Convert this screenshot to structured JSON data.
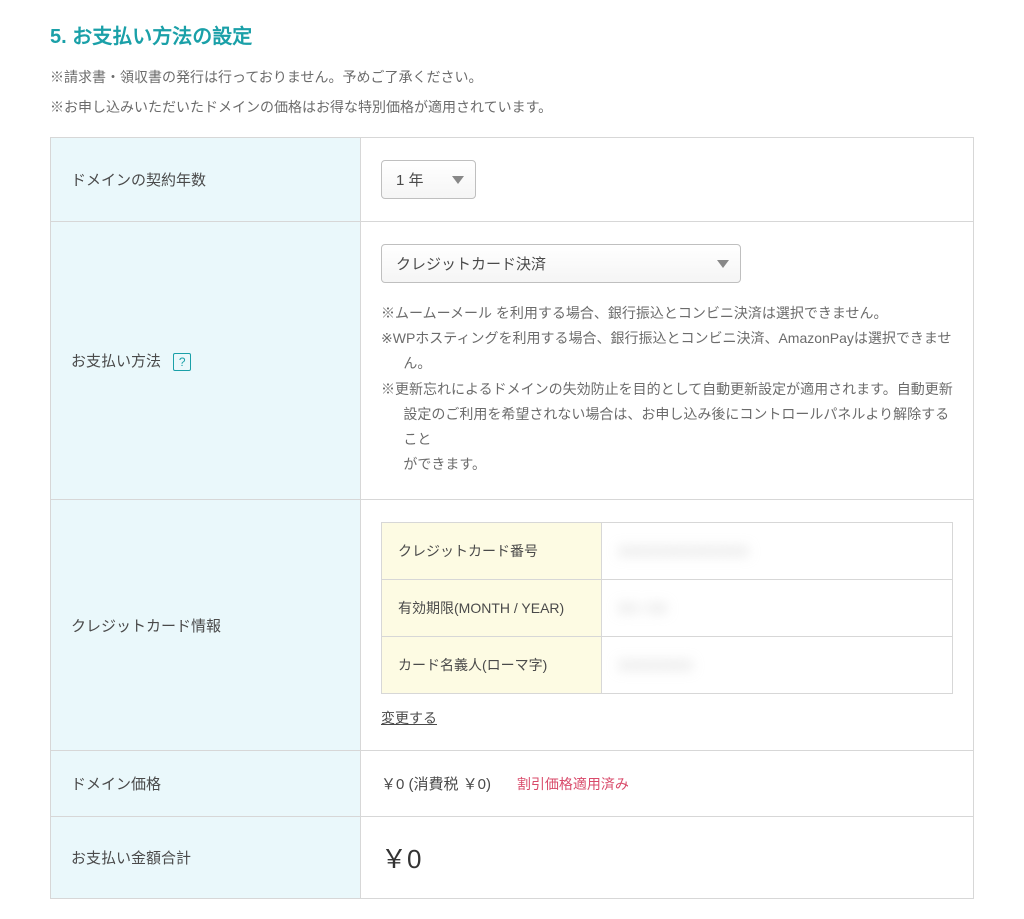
{
  "section": {
    "title": "5. お支払い方法の設定",
    "note1": "※請求書・領収書の発行は行っておりません。予めご了承ください。",
    "note2": "※お申し込みいただいたドメインの価格はお得な特別価格が適用されています。"
  },
  "rows": {
    "contractYears": {
      "label": "ドメインの契約年数",
      "selected": "1 年"
    },
    "paymentMethod": {
      "label": "お支払い方法",
      "helpIcon": "?",
      "selected": "クレジットカード決済",
      "notes": {
        "n1": "※ムームーメール を利用する場合、銀行振込とコンビニ決済は選択できません。",
        "n2a": "※WPホスティングを利用する場合、銀行振込とコンビニ決済、AmazonPayは選択できませ",
        "n2b": "ん。",
        "n3a": "※更新忘れによるドメインの失効防止を目的として自動更新設定が適用されます。自動更新",
        "n3b": "設定のご利用を希望されない場合は、お申し込み後にコントロールパネルより解除すること",
        "n3c": "ができます。"
      }
    },
    "cardInfo": {
      "label": "クレジットカード情報",
      "fields": {
        "number": {
          "label": "クレジットカード番号",
          "value": "XXXXXXXXXXXXXX"
        },
        "expiry": {
          "label": "有効期限(MONTH / YEAR)",
          "value": "XX / XX"
        },
        "holder": {
          "label": "カード名義人(ローマ字)",
          "value": "XXXXXXXX"
        }
      },
      "changeLink": "変更する"
    },
    "domainPrice": {
      "label": "ドメイン価格",
      "text": "￥0 (消費税 ￥0)",
      "discount": "割引価格適用済み"
    },
    "total": {
      "label": "お支払い金額合計",
      "amount": "￥0"
    }
  }
}
